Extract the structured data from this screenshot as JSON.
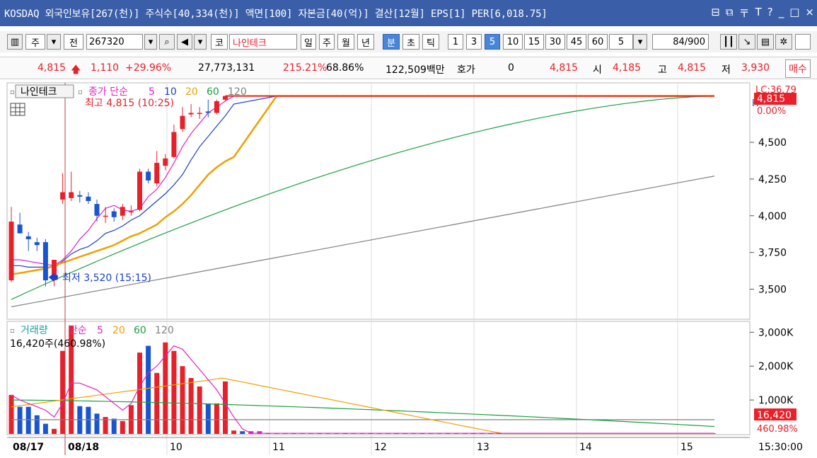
{
  "title": "KOSDAQ 외국인보유[267(천)] 주식수[40,334(천)] 액면[100] 자본금[40(억)] 결산[12월] EPS[1] PER[6,018.75]",
  "window_icons": [
    "⊟",
    "⧉",
    "〒",
    "T",
    "?",
    "_",
    "□",
    "×"
  ],
  "toolbar": {
    "market": "주",
    "prefix": "전",
    "code": "267320",
    "market_short": "코",
    "stock_name": "나인테크",
    "periods": [
      "일",
      "주",
      "월",
      "년",
      "분",
      "초",
      "틱"
    ],
    "selected_period": "분",
    "intervals": [
      "1",
      "3",
      "5",
      "10",
      "15",
      "30",
      "45",
      "60"
    ],
    "selected_interval": "5",
    "interval_value": "5",
    "count": "84",
    "count_total": "/900"
  },
  "quote": {
    "price": "4,815",
    "change": "1,110",
    "change_pct": "+29.96%",
    "volume": "27,773,131",
    "volume_ratio": "215.21%",
    "turnover": "68.86%",
    "amount": "122,509백만",
    "hoga_label": "호가",
    "hoga_value": "0",
    "price2": "4,815",
    "open_label": "시",
    "open": "4,185",
    "high_label": "고",
    "high": "4,815",
    "low_label": "저",
    "low": "3,930",
    "trade_button": "매수"
  },
  "price_panel": {
    "name": "나인테크",
    "legend_prefix": "종가 단순",
    "ma": [
      "5",
      "10",
      "20",
      "60",
      "120"
    ],
    "ma_colors": [
      "#e020c0",
      "#1a3fd0",
      "#f0a000",
      "#1aa040",
      "#808080"
    ],
    "high_note": "최고 4,815 (10:25)",
    "low_note": "최저 3,520 (15:15)",
    "lc_label": "LC:36.79",
    "h_label": "H",
    "current_tag": "4,815",
    "pct_tag": "0.00%",
    "y_ticks": [
      "4,500",
      "4,250",
      "4,000",
      "3,750",
      "3,500"
    ]
  },
  "volume_panel": {
    "name": "거래량",
    "legend_prefix": "단순",
    "ma": [
      "5",
      "20",
      "60",
      "120"
    ],
    "ma_colors": [
      "#e020c0",
      "#f0a000",
      "#1aa040",
      "#808080"
    ],
    "note": "16,420주(460.98%)",
    "current_tag": "16,420",
    "pct_tag": "460.98%",
    "y_ticks": [
      "3,000K",
      "2,000K",
      "1,000K"
    ]
  },
  "x_labels": [
    "08/17",
    "08/18",
    "10",
    "11",
    "12",
    "13",
    "14",
    "15",
    "15:30:00"
  ],
  "chart_data": [
    {
      "type": "candlestick",
      "title": "나인테크",
      "ylim": [
        3300,
        4900
      ],
      "candles": [
        {
          "o": 3560,
          "h": 4060,
          "l": 3550,
          "c": 3960
        },
        {
          "o": 3940,
          "h": 4020,
          "l": 3880,
          "c": 3880
        },
        {
          "o": 3860,
          "h": 3890,
          "l": 3760,
          "c": 3840
        },
        {
          "o": 3820,
          "h": 3850,
          "l": 3760,
          "c": 3800
        },
        {
          "o": 3820,
          "h": 3840,
          "l": 3520,
          "c": 3560
        },
        {
          "o": 3560,
          "h": 3700,
          "l": 3520,
          "c": 3700
        },
        {
          "o": 4110,
          "h": 4290,
          "l": 4080,
          "c": 4160
        },
        {
          "o": 4120,
          "h": 4300,
          "l": 4100,
          "c": 4160
        },
        {
          "o": 4140,
          "h": 4170,
          "l": 4090,
          "c": 4130
        },
        {
          "o": 4130,
          "h": 4160,
          "l": 4080,
          "c": 4100
        },
        {
          "o": 4080,
          "h": 4110,
          "l": 3960,
          "c": 4000
        },
        {
          "o": 4000,
          "h": 4060,
          "l": 3950,
          "c": 4000
        },
        {
          "o": 4030,
          "h": 4050,
          "l": 3960,
          "c": 3990
        },
        {
          "o": 4000,
          "h": 4080,
          "l": 3970,
          "c": 4060
        },
        {
          "o": 4030,
          "h": 4070,
          "l": 4000,
          "c": 4030
        },
        {
          "o": 4040,
          "h": 4320,
          "l": 4030,
          "c": 4300
        },
        {
          "o": 4300,
          "h": 4320,
          "l": 4220,
          "c": 4240
        },
        {
          "o": 4220,
          "h": 4440,
          "l": 4200,
          "c": 4360
        },
        {
          "o": 4340,
          "h": 4420,
          "l": 4310,
          "c": 4390
        },
        {
          "o": 4400,
          "h": 4620,
          "l": 4390,
          "c": 4570
        },
        {
          "o": 4590,
          "h": 4740,
          "l": 4570,
          "c": 4680
        },
        {
          "o": 4690,
          "h": 4760,
          "l": 4670,
          "c": 4700
        },
        {
          "o": 4700,
          "h": 4740,
          "l": 4660,
          "c": 4700
        },
        {
          "o": 4710,
          "h": 4790,
          "l": 4670,
          "c": 4700
        },
        {
          "o": 4700,
          "h": 4790,
          "l": 4690,
          "c": 4780
        },
        {
          "o": 4790,
          "h": 4815,
          "l": 4780,
          "c": 4815
        }
      ],
      "flat_close": 4815,
      "total_bars": 84,
      "ma_series": [
        {
          "name": "5",
          "color": "#e020c0",
          "values": [
            3700,
            3700,
            3690,
            3680,
            3670,
            3660,
            3700,
            3760,
            3840,
            3900,
            3980,
            4050,
            4070,
            4040,
            4030,
            4050,
            4130,
            4180,
            4260,
            4360,
            4470,
            4560,
            4630,
            4700,
            4740,
            4780,
            4815
          ]
        },
        {
          "name": "10",
          "color": "#1a3fd0",
          "values": [
            3660,
            3660,
            3650,
            3650,
            3650,
            3650,
            3690,
            3740,
            3770,
            3790,
            3830,
            3880,
            3900,
            3930,
            3970,
            4000,
            4050,
            4100,
            4150,
            4210,
            4280,
            4380,
            4470,
            4540,
            4610,
            4680,
            4760
          ]
        },
        {
          "name": "20",
          "color": "#f0a000",
          "values": [
            3600,
            3610,
            3620,
            3630,
            3640,
            3660,
            3680,
            3700,
            3720,
            3740,
            3760,
            3780,
            3800,
            3830,
            3860,
            3880,
            3910,
            3940,
            3990,
            4030,
            4080,
            4140,
            4210,
            4280,
            4330,
            4370,
            4400
          ]
        },
        {
          "name": "60",
          "color": "#1aa040",
          "start": 3430,
          "end": 4815
        },
        {
          "name": "120",
          "color": "#808080",
          "start": 3380,
          "end": 4270
        }
      ]
    },
    {
      "type": "bar",
      "title": "거래량",
      "ylim": [
        0,
        3300000
      ],
      "volumes": [
        1150000,
        800000,
        800000,
        550000,
        300000,
        150000,
        2450000,
        3200000,
        820000,
        800000,
        600000,
        500000,
        450000,
        380000,
        850000,
        2400000,
        2600000,
        1800000,
        2700000,
        2450000,
        2000000,
        1650000,
        1400000,
        900000,
        900000,
        1550000,
        100000
      ],
      "current_volume": 16420
    }
  ]
}
